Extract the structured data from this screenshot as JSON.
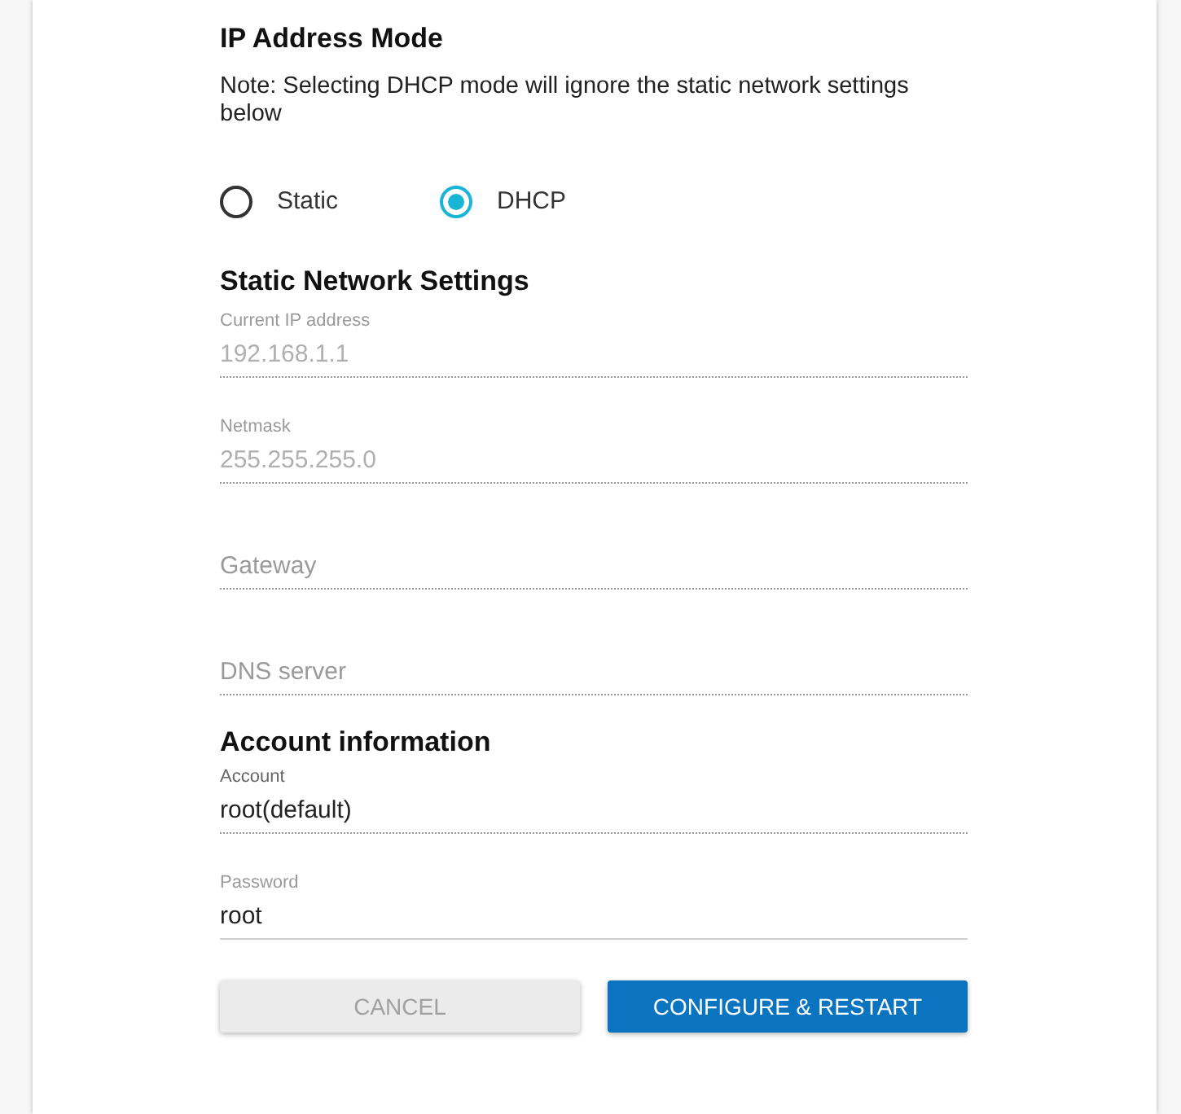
{
  "ip_mode": {
    "heading": "IP Address Mode",
    "note": "Note: Selecting DHCP mode will ignore the static network settings below",
    "options": [
      {
        "label": "Static",
        "selected": false
      },
      {
        "label": "DHCP",
        "selected": true
      }
    ]
  },
  "static_network": {
    "heading": "Static Network Settings",
    "fields": [
      {
        "label": "Current IP address",
        "value": "192.168.1.1",
        "disabled": true
      },
      {
        "label": "Netmask",
        "value": "255.255.255.0",
        "disabled": true
      },
      {
        "placeholder": "Gateway",
        "disabled": true
      },
      {
        "placeholder": "DNS server",
        "disabled": true
      }
    ]
  },
  "account": {
    "heading": "Account information",
    "fields": [
      {
        "label": "Account",
        "value": "root(default)",
        "disabled": true,
        "readonly": true
      },
      {
        "label": "Password",
        "value": "root",
        "disabled": false
      }
    ]
  },
  "buttons": [
    {
      "label": "CANCEL",
      "disabled": true
    },
    {
      "label": "CONFIGURE & RESTART",
      "disabled": false
    }
  ]
}
